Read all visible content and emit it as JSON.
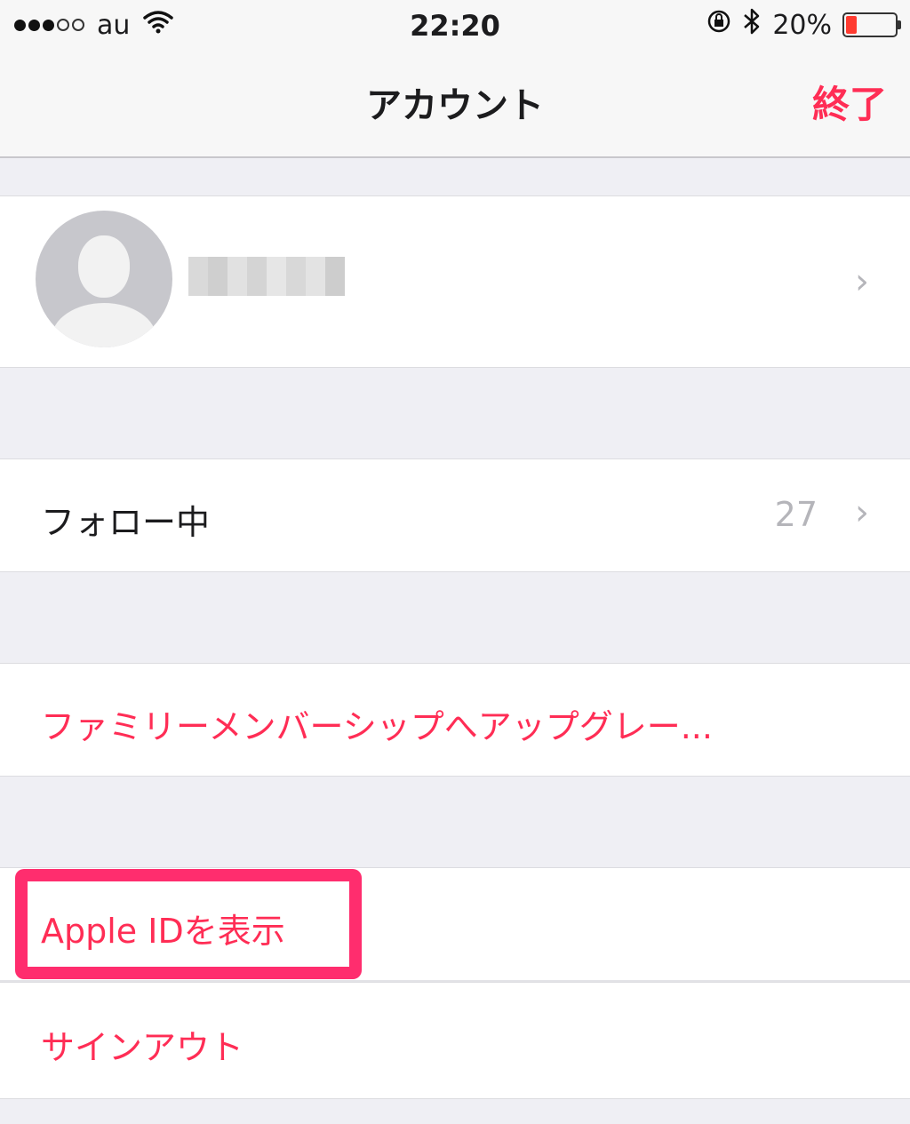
{
  "status_bar": {
    "carrier": "au",
    "time": "22:20",
    "battery_percent": "20%",
    "battery_level": 0.2,
    "signal_dots_filled": 3,
    "signal_dots_total": 5
  },
  "nav": {
    "title": "アカウント",
    "done_label": "終了"
  },
  "profile": {
    "name_redacted": true
  },
  "following": {
    "label": "フォロー中",
    "count": "27"
  },
  "family_upgrade": {
    "label": "ファミリーメンバーシップへアップグレー..."
  },
  "apple_id": {
    "label": "Apple IDを表示"
  },
  "sign_out": {
    "label": "サインアウト"
  },
  "colors": {
    "accent": "#ff2d55",
    "highlight_border": "#ff2d6e",
    "background": "#efeff4"
  }
}
